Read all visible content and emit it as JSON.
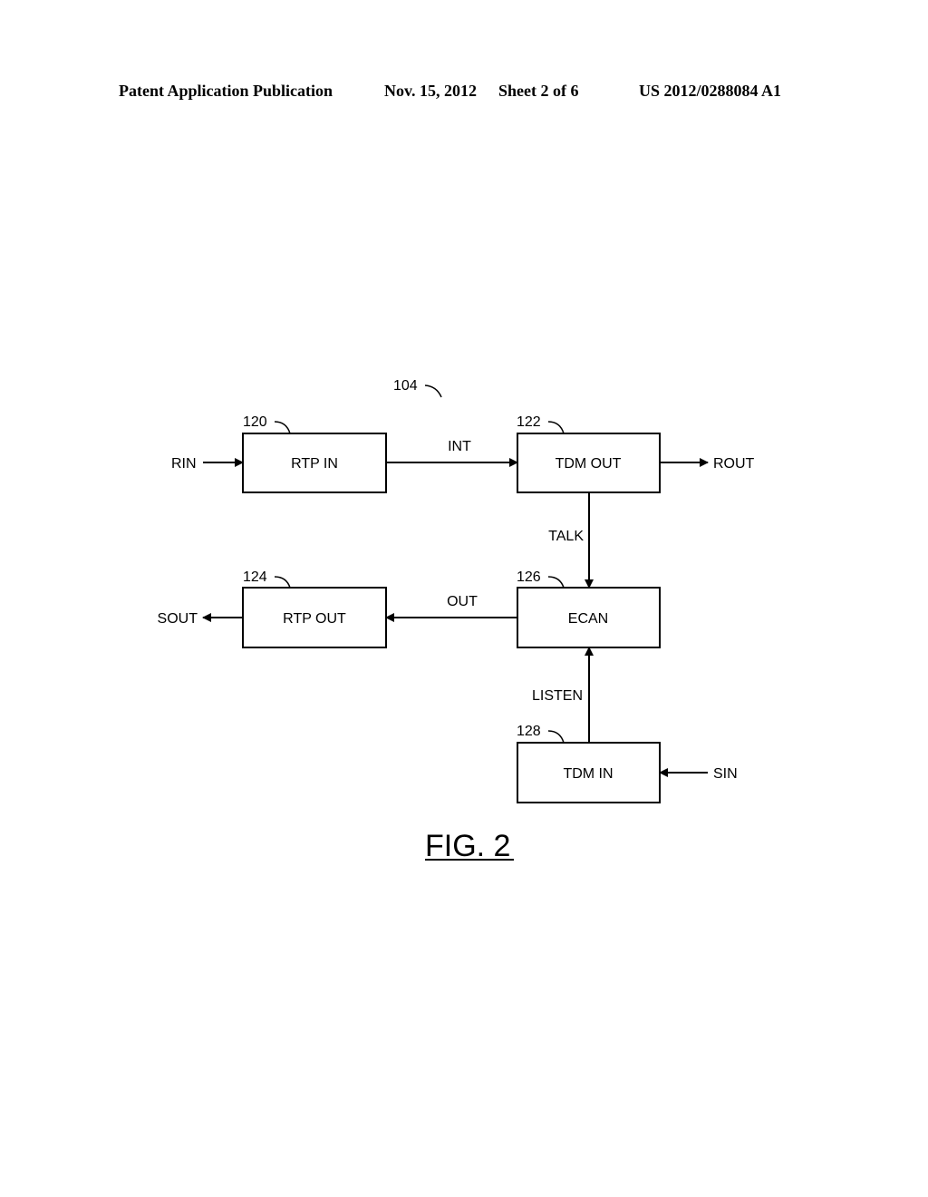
{
  "header": {
    "publication": "Patent Application Publication",
    "date": "Nov. 15, 2012",
    "sheet": "Sheet 2 of 6",
    "number": "US 2012/0288084 A1"
  },
  "diagram": {
    "ref": "104",
    "blocks": [
      {
        "id": "rtp_in",
        "label": "RTP IN",
        "ref": "120"
      },
      {
        "id": "tdm_out",
        "label": "TDM OUT",
        "ref": "122"
      },
      {
        "id": "rtp_out",
        "label": "RTP OUT",
        "ref": "124"
      },
      {
        "id": "ecan",
        "label": "ECAN",
        "ref": "126"
      },
      {
        "id": "tdm_in",
        "label": "TDM IN",
        "ref": "128"
      }
    ],
    "signals": {
      "rin": "RIN",
      "int": "INT",
      "rout": "ROUT",
      "talk": "TALK",
      "out": "OUT",
      "sout": "SOUT",
      "listen": "LISTEN",
      "sin": "SIN"
    },
    "connections": [
      {
        "from": "RIN",
        "to": "rtp_in"
      },
      {
        "from": "rtp_in",
        "to": "tdm_out",
        "signal": "INT"
      },
      {
        "from": "tdm_out",
        "to": "ROUT"
      },
      {
        "from": "tdm_out",
        "to": "ecan",
        "signal": "TALK"
      },
      {
        "from": "ecan",
        "to": "rtp_out",
        "signal": "OUT"
      },
      {
        "from": "rtp_out",
        "to": "SOUT"
      },
      {
        "from": "tdm_in",
        "to": "ecan",
        "signal": "LISTEN"
      },
      {
        "from": "SIN",
        "to": "tdm_in"
      }
    ],
    "figure_label": "FIG. 2"
  }
}
